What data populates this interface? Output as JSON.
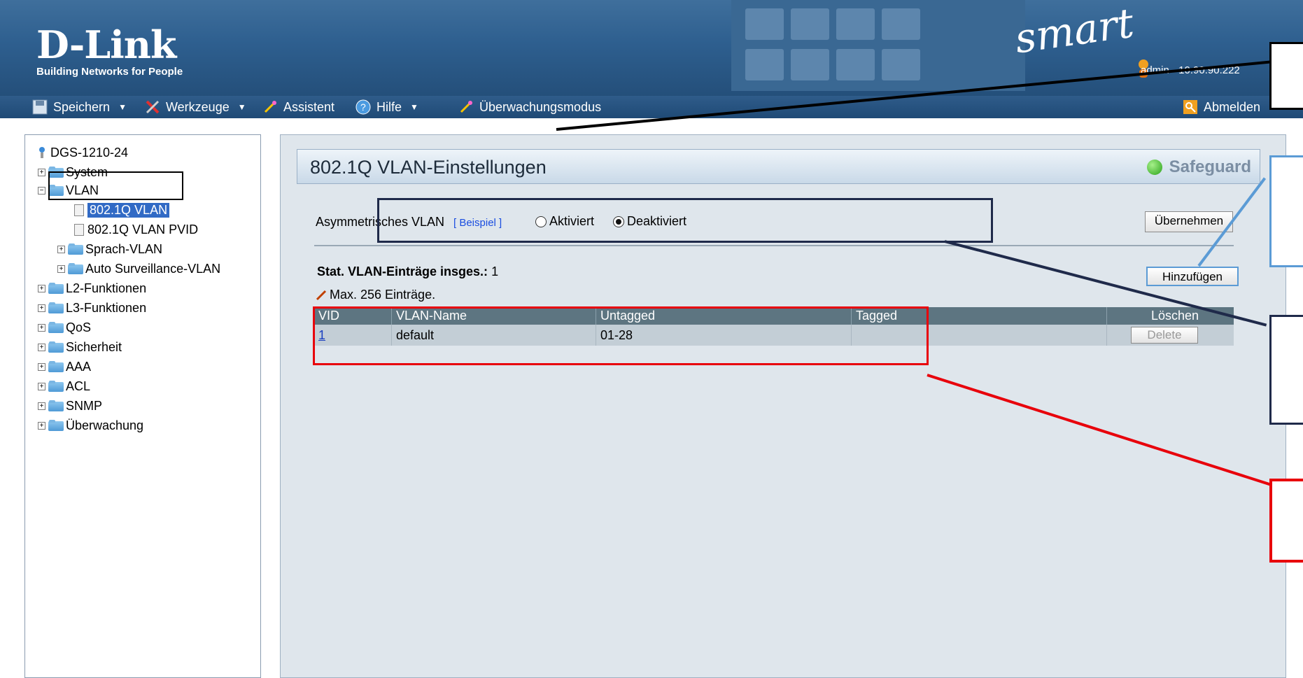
{
  "header": {
    "logo_title": "D-Link",
    "logo_tagline": "Building Networks for People",
    "smart_logo": "smart",
    "user_info": "admin - 10.90.90.222"
  },
  "toolbar": {
    "save_label": "Speichern",
    "tools_label": "Werkzeuge",
    "wizard_label": "Assistent",
    "help_label": "Hilfe",
    "monitor_label": "Überwachungsmodus",
    "logout_label": "Abmelden"
  },
  "tree": {
    "root": "DGS-1210-24",
    "items": [
      {
        "label": "System"
      },
      {
        "label": "VLAN"
      },
      {
        "label": "802.1Q VLAN"
      },
      {
        "label": "802.1Q VLAN PVID"
      },
      {
        "label": "Sprach-VLAN"
      },
      {
        "label": "Auto Surveillance-VLAN"
      },
      {
        "label": "L2-Funktionen"
      },
      {
        "label": "L3-Funktionen"
      },
      {
        "label": "QoS"
      },
      {
        "label": "Sicherheit"
      },
      {
        "label": "AAA"
      },
      {
        "label": "ACL"
      },
      {
        "label": "SNMP"
      },
      {
        "label": "Überwachung"
      }
    ]
  },
  "main": {
    "title": "802.1Q VLAN-Einstellungen",
    "safeguard_label": "Safeguard",
    "asym_label": "Asymmetrisches VLAN",
    "example_link": "[ Beispiel ]",
    "radio_enabled": "Aktiviert",
    "radio_disabled": "Deaktiviert",
    "apply_button": "Übernehmen",
    "static_entries_label": "Stat. VLAN-Einträge insges.:",
    "static_entries_count": "1",
    "max_entries": "Max. 256 Einträge.",
    "add_button": "Hinzufügen",
    "table": {
      "headers": [
        "VID",
        "VLAN-Name",
        "Untagged",
        "Tagged",
        "Löschen"
      ],
      "rows": [
        {
          "vid": "1",
          "name": "default",
          "untagged": "01-28",
          "tagged": "",
          "delete": "Delete"
        }
      ]
    }
  },
  "colors": {
    "annotation_black": "#000000",
    "annotation_navy": "#1f2a4a",
    "annotation_lightblue": "#5b9bd5",
    "annotation_red": "#e8000b"
  }
}
